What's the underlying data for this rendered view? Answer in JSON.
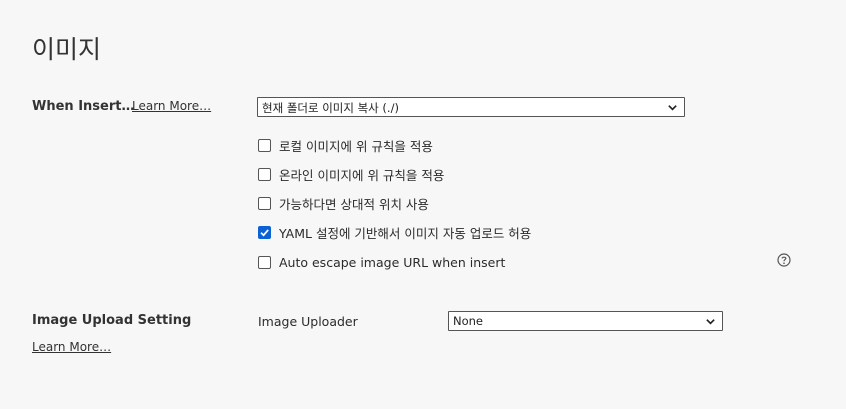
{
  "page": {
    "title": "이미지"
  },
  "insert_section": {
    "label": "When Insert…",
    "learn_more": "Learn More…",
    "action_select": {
      "value": "현재 폴더로 이미지 복사 (./)"
    },
    "options": [
      {
        "label": "로컬 이미지에 위 규칙을 적용",
        "checked": false
      },
      {
        "label": "온라인 이미지에 위 규칙을 적용",
        "checked": false
      },
      {
        "label": "가능하다면 상대적 위치 사용",
        "checked": false
      },
      {
        "label": "YAML 설정에 기반해서 이미지 자동 업로드 허용",
        "checked": true
      },
      {
        "label": "Auto escape image URL when insert",
        "checked": false
      }
    ],
    "help_icon": "question-circle-icon"
  },
  "upload_section": {
    "label": "Image Upload Setting",
    "learn_more": "Learn More…",
    "uploader_label": "Image Uploader",
    "uploader_select": {
      "value": "None"
    }
  },
  "colors": {
    "accent": "#0b61d6",
    "background": "#f7f7f8",
    "text": "#2b2b2b"
  }
}
